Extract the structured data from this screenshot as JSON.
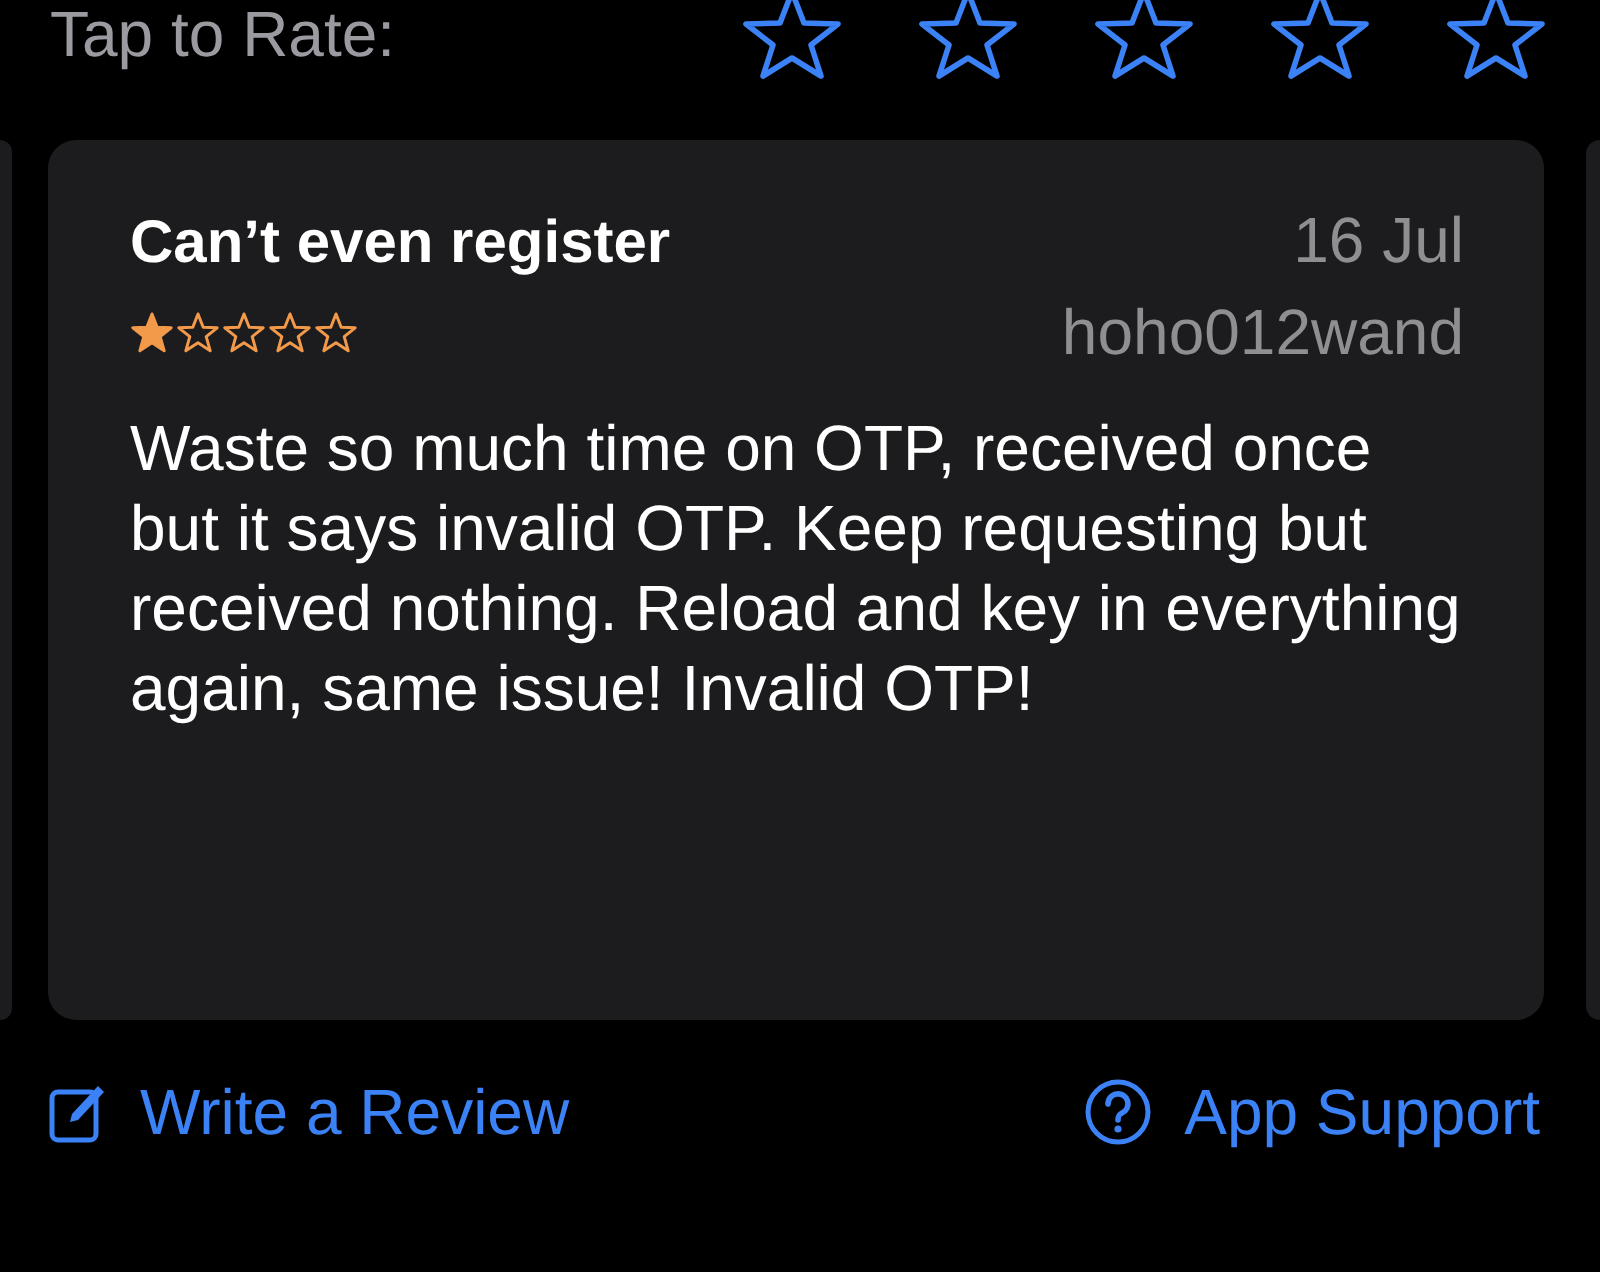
{
  "rate_prompt": {
    "label": "Tap to Rate:",
    "stars": 0
  },
  "review": {
    "title": "Can’t even register",
    "date": "16 Jul",
    "stars": 1,
    "author": "hoho012wand",
    "body": "Waste so much time on OTP, received once but it says invalid OTP. Keep requesting but received nothing. Reload and key in everything again, same issue! Invalid OTP!"
  },
  "actions": [
    {
      "kind": "write",
      "label": "Write a Review"
    },
    {
      "kind": "support",
      "label": "App Support"
    }
  ]
}
